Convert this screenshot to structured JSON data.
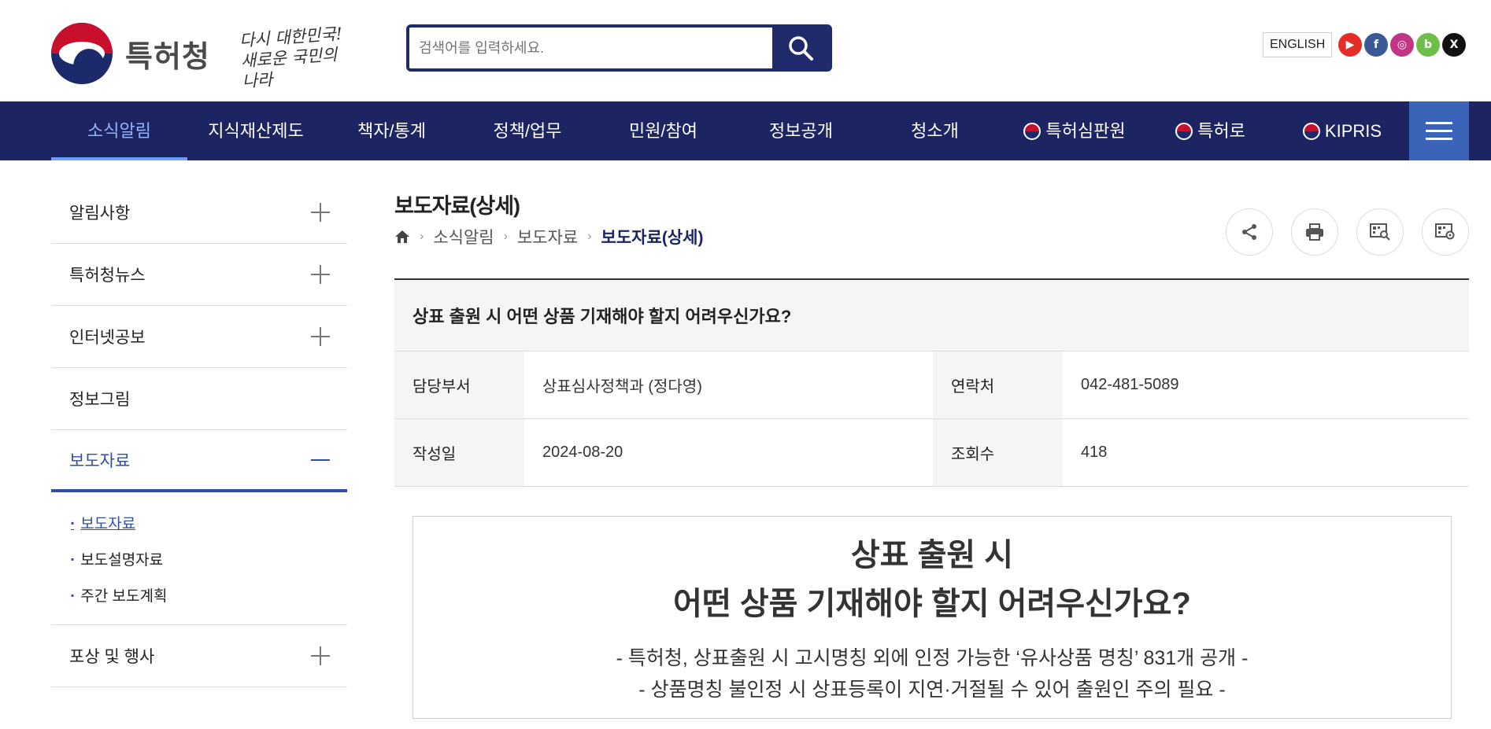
{
  "header": {
    "logo_text": "특허청",
    "slogan_line1": "다시 대한민국!",
    "slogan_line2": "새로운 국민의 나라",
    "search_placeholder": "검색어를 입력하세요.",
    "english_label": "ENGLISH",
    "social": [
      {
        "icon": "youtube-icon",
        "glyph": "▶",
        "color": "#e52d27"
      },
      {
        "icon": "facebook-icon",
        "glyph": "f",
        "color": "#3b5998"
      },
      {
        "icon": "instagram-icon",
        "glyph": "◎",
        "color": "#c13584"
      },
      {
        "icon": "blog-icon",
        "glyph": "b",
        "color": "#6cc04a"
      },
      {
        "icon": "x-icon",
        "glyph": "𝕏",
        "color": "#111111"
      }
    ]
  },
  "nav": {
    "items": [
      {
        "label": "소식알림"
      },
      {
        "label": "지식재산제도"
      },
      {
        "label": "책자/통계"
      },
      {
        "label": "정책/업무"
      },
      {
        "label": "민원/참여"
      },
      {
        "label": "정보공개"
      },
      {
        "label": "청소개"
      },
      {
        "label": "특허심판원"
      },
      {
        "label": "특허로"
      },
      {
        "label": "KIPRIS"
      }
    ]
  },
  "sidebar": {
    "items": [
      {
        "label": "알림사항"
      },
      {
        "label": "특허청뉴스"
      },
      {
        "label": "인터넷공보"
      },
      {
        "label": "정보그림"
      },
      {
        "label": "보도자료"
      },
      {
        "label": "포상 및 행사"
      }
    ],
    "sub_items": [
      {
        "label": "보도자료"
      },
      {
        "label": "보도설명자료"
      },
      {
        "label": "주간 보도계획"
      }
    ]
  },
  "main": {
    "page_title": "보도자료(상세)",
    "breadcrumb": [
      "소식알림",
      "보도자료",
      "보도자료(상세)"
    ],
    "article_title": "상표 출원 시 어떤 상품 기재해야 할지 어려우신가요?",
    "dept_label": "담당부서",
    "dept_value": "상표심사정책과 (정다영)",
    "contact_label": "연락처",
    "contact_value": "042-481-5089",
    "date_label": "작성일",
    "date_value": "2024-08-20",
    "views_label": "조회수",
    "views_value": "418",
    "content_heading_line1": "상표 출원 시",
    "content_heading_line2": "어떤 상품 기재해야 할지 어려우신가요?",
    "content_sub_line1": "- 특허청, 상표출원 시 고시명칭 외에 인정 가능한 ‘유사상품 명칭’ 831개 공개 -",
    "content_sub_line2": "- 상품명칭 불인정 시 상표등록이 지연·거절될 수 있어 출원인 주의 필요 -"
  }
}
